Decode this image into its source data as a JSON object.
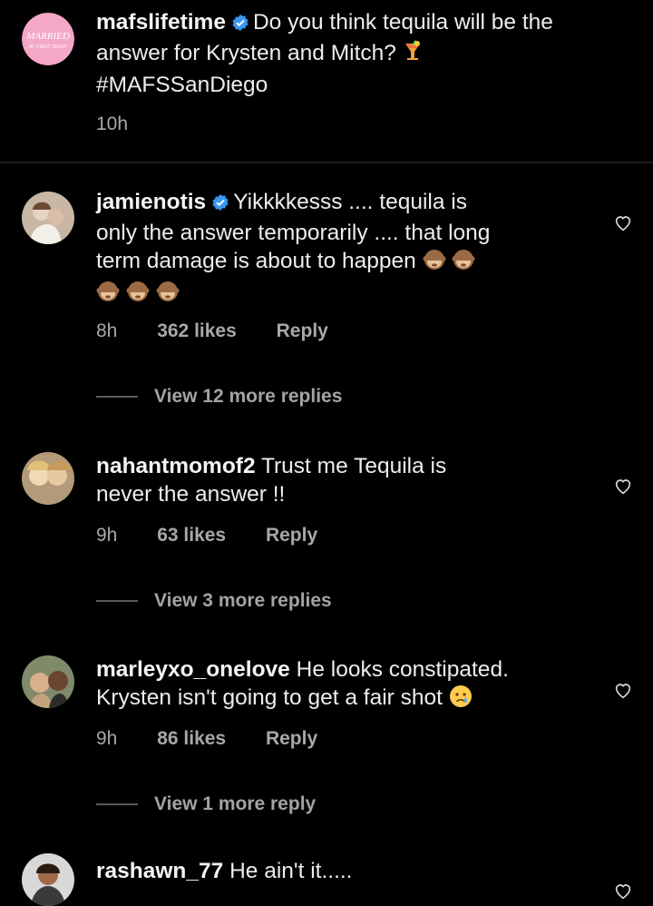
{
  "caption": {
    "username": "mafslifetime",
    "text_line1": "Do you think tequila will be the",
    "text_line2": "answer for Krysten and Mitch?",
    "hashtag": "#MAFSSanDiego",
    "time": "10h",
    "avatar_logo_line1": "MARRIED",
    "avatar_logo_line2": "AT FIRST SIGHT",
    "avatar_color": "#f4a7c6"
  },
  "comments": [
    {
      "username": "jamienotis",
      "text_line1": "Yikkkkesss .... tequila is",
      "text_line2": "only the answer temporarily .... that long",
      "text_line3": "term damage is about to happen",
      "time": "8h",
      "likes": "362 likes",
      "reply": "Reply",
      "view_more": "View 12 more replies"
    },
    {
      "username": "nahantmomof2",
      "text_line1": "Trust me Tequila is",
      "text_line2": "never the answer !!",
      "time": "9h",
      "likes": "63 likes",
      "reply": "Reply",
      "view_more": "View 3 more replies"
    },
    {
      "username": "marleyxo_onelove",
      "text_line1": "He looks constipated.",
      "text_line2": "Krysten isn't going to get a fair shot",
      "time": "9h",
      "likes": "86 likes",
      "reply": "Reply",
      "view_more": "View 1 more reply"
    },
    {
      "username": "rashawn_77",
      "text_line1": "He ain't it....."
    }
  ],
  "icons": {
    "verified": "verified-badge-icon",
    "heart": "heart-outline-icon",
    "emoji_drink": "tropical-drink-emoji",
    "emoji_monkey": "see-no-evil-monkey-emoji",
    "emoji_cry": "crying-face-emoji"
  },
  "colors": {
    "background": "#000000",
    "text": "#ededed",
    "meta": "#a8a8a8",
    "verified": "#3897f0"
  }
}
